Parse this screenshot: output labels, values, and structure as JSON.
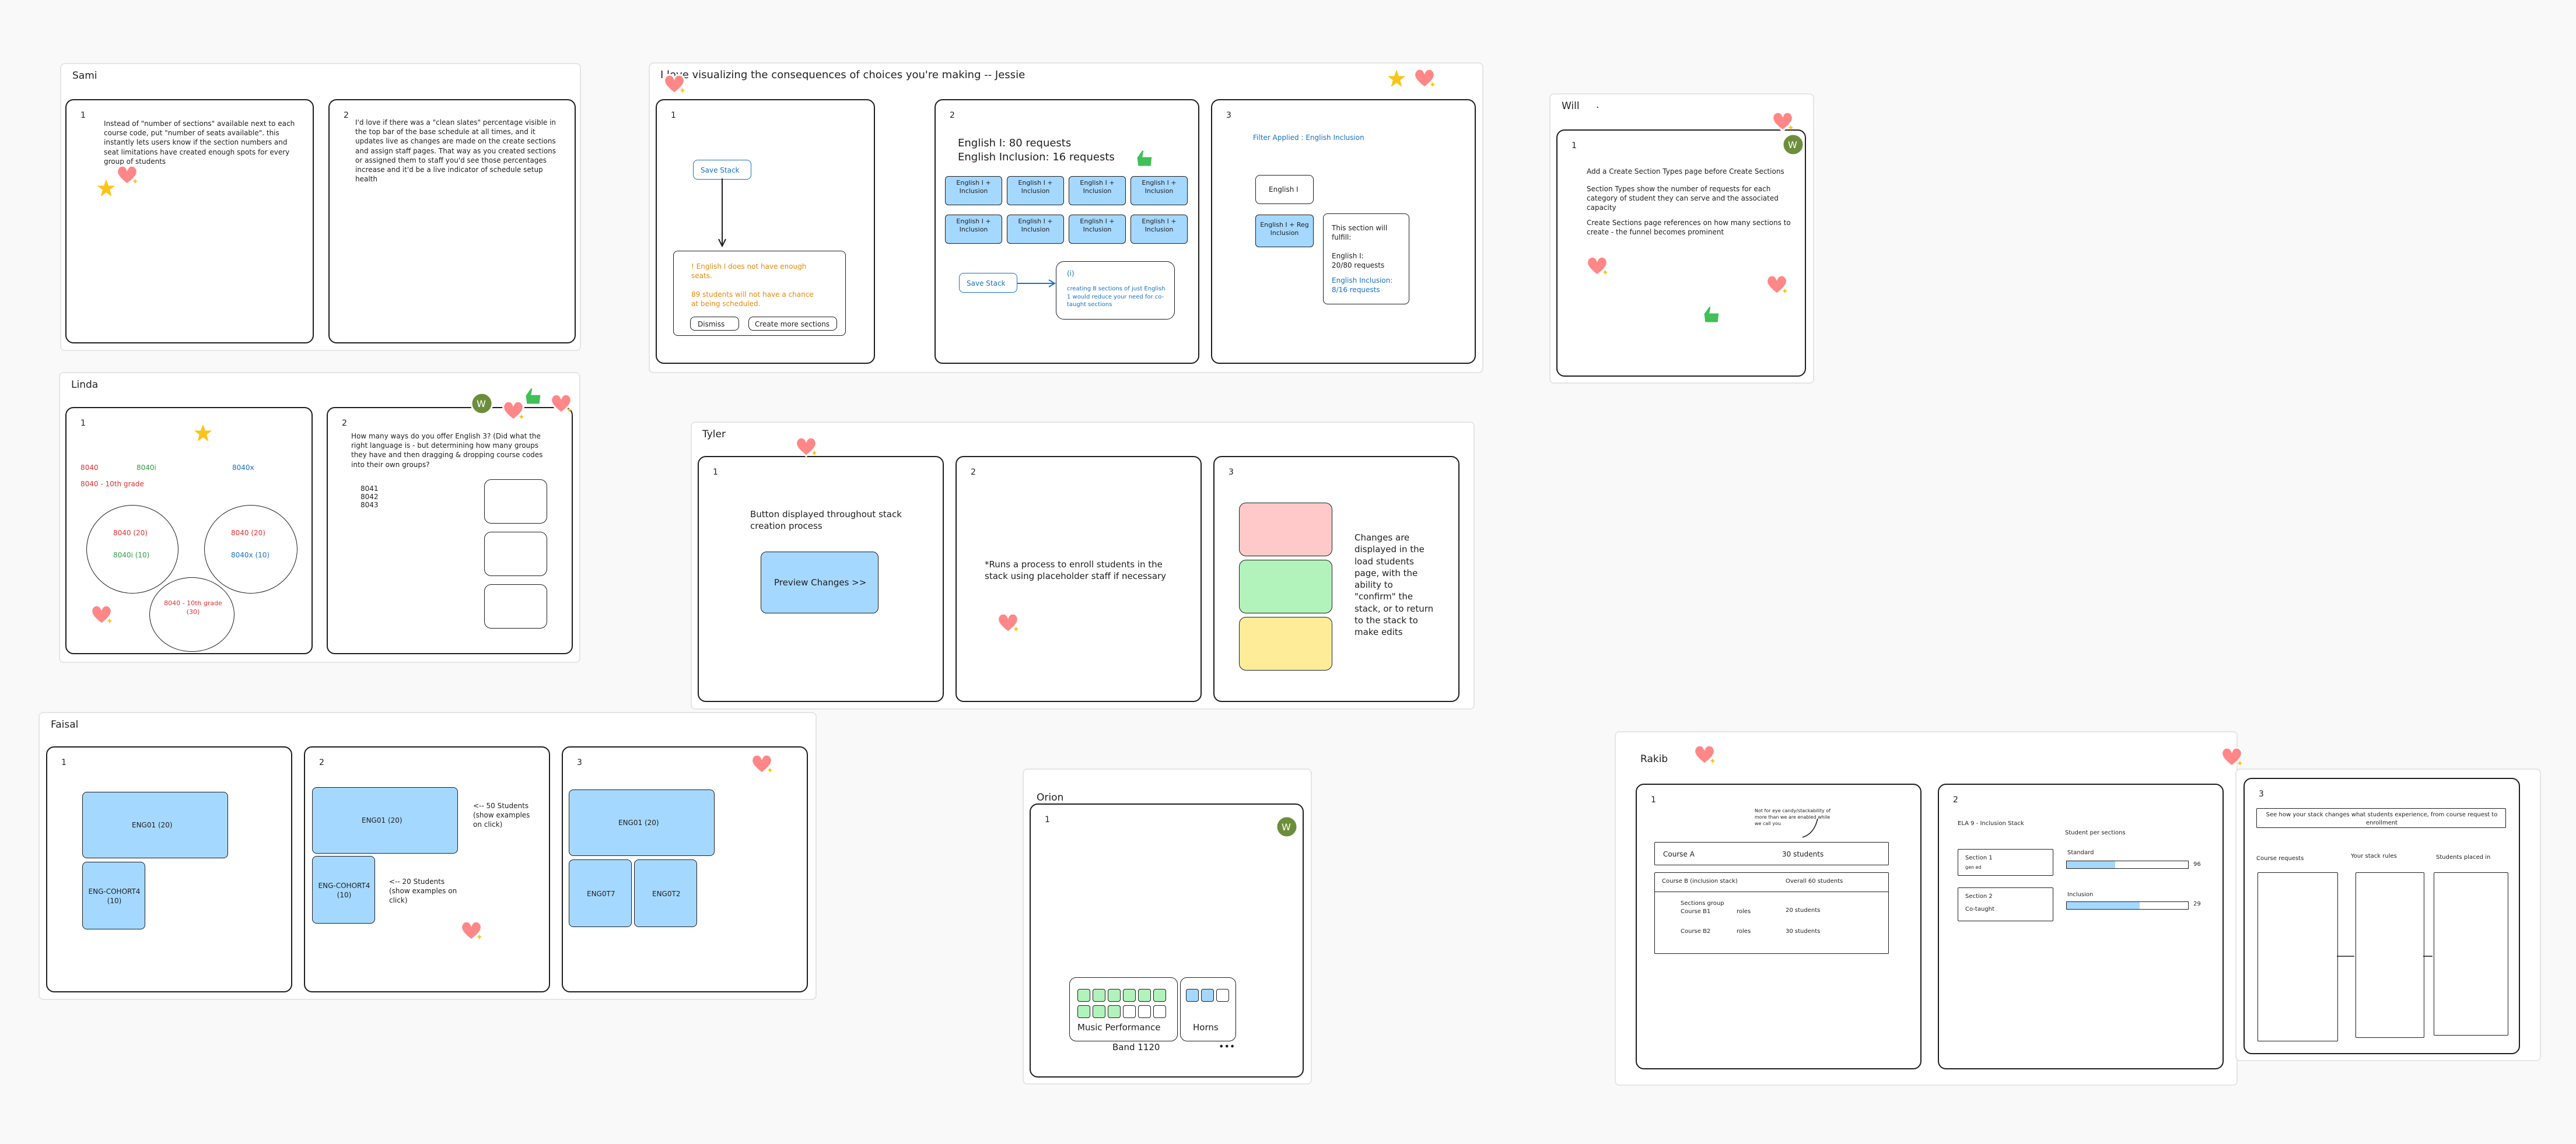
{
  "frames": {
    "sami": {
      "title": "Sami"
    },
    "jessie": {
      "title": "I love visualizing the consequences of choices you're making -- Jessie"
    },
    "will": {
      "title": "Will",
      "dot": "."
    },
    "linda": {
      "title": "Linda"
    },
    "tyler": {
      "title": "Tyler"
    },
    "faisal": {
      "title": "Faisal"
    },
    "orion": {
      "title": "Orion"
    },
    "rakib": {
      "title": "Rakib"
    }
  },
  "cards": {
    "sami1": {
      "num": "1",
      "text": "Instead of \"number of sections\" available next to each course code, put \"number of seats available\". this instantly lets users know if the section numbers and seat limitations have created enough spots for every group of students"
    },
    "sami2": {
      "num": "2",
      "text": "I'd love if there was a \"clean slates\" percentage visible in the top bar of the base schedule at all times, and it updates live as changes are made on the create sections and assign staff pages. That way as you created sections or assigned them to staff you'd see those percentages increase and it'd be a live indicator of schedule setup health"
    },
    "jessie1": {
      "num": "1",
      "save": "Save Stack",
      "warn1": "! English I does not have enough seats.",
      "warn2": "89 students will not have a chance at being scheduled.",
      "btn_dismiss": "Dismiss",
      "btn_create": "Create more sections"
    },
    "jessie2": {
      "num": "2",
      "head1": "English I: 80 requests",
      "head2": "English Inclusion: 16 requests",
      "cell": "English I + Inclusion",
      "save": "Save Stack",
      "note_mark": "(i)",
      "note": "creating 8 sections of just English 1 would reduce your need for co-taught sections"
    },
    "jessie3": {
      "num": "3",
      "filter": "Filter Applied : English Inclusion",
      "eng1": "English I",
      "eng_reg": "English I + Reg Inclusion",
      "fulfill": "This section will fulfill:",
      "eng_count": "English I:",
      "eng_req": "20/80 requests",
      "incl": "English Inclusion:",
      "incl_req": "8/16 requests"
    },
    "will1": {
      "num": "1",
      "line1": "Add a Create Section Types page before Create Sections",
      "line2": "Section Types show the number of requests for each category of student they can serve and the associated capacity",
      "line3": "Create Sections page references on how many sections to create - the funnel becomes prominent"
    },
    "linda1": {
      "num": "1",
      "a": "8040",
      "b": "8040x",
      "c": "8040i",
      "d": "8040 - 10th grade",
      "e1": "8040 (20)",
      "e2": "8040x (10)",
      "f1": "8040 (20)",
      "f2": "8040i (10)",
      "g": "8040 - 10th grade (30)"
    },
    "linda2": {
      "num": "2",
      "text": "How many ways do you offer English 3? (Did what the right language is - but determining how many groups they have and then dragging & dropping course codes into their own groups?",
      "codes": [
        "8041",
        "8042",
        "8043"
      ]
    },
    "tyler1": {
      "num": "1",
      "caption": "Button displayed throughout stack creation process",
      "btn": "Preview Changes >>"
    },
    "tyler2": {
      "num": "2",
      "text": "*Runs a process to enroll students in the stack using placeholder staff if necessary"
    },
    "tyler3": {
      "num": "3",
      "text": "Changes are displayed in the load students page, with the ability to \"confirm\" the stack, or to return to the stack to make edits"
    },
    "faisal1": {
      "num": "1",
      "big": "ENG01 (20)",
      "small": "ENG-COHORT4 (10)"
    },
    "faisal2": {
      "num": "2",
      "big": "ENG01 (20)",
      "small": "ENG-COHORT4 (10)",
      "note1": "<-- 50 Students (show examples on click)",
      "note2": "<-- 20 Students (show examples on click)"
    },
    "faisal3": {
      "num": "3",
      "big": "ENG01 (20)",
      "s1": "ENG0T7",
      "s2": "ENG0T2"
    },
    "orion1": {
      "num": "1",
      "label1": "Music Performance",
      "label2": "Horns",
      "band": "Band 1120",
      "dots": "•••"
    },
    "rakib1": {
      "num": "1",
      "top": "Not for eye candy/stackability of more than we are enabled while we call you",
      "course_a": "Course A",
      "stud30": "30 students",
      "course_b": "Course B (inclusion stack)",
      "overall": "Overall 60 students",
      "group": "Sections group Course B1",
      "roles1": "roles",
      "stud20": "20 students",
      "b2": "Course B2",
      "roles2": "roles",
      "stud30b": "30 students"
    },
    "rakib2": {
      "num": "2",
      "head": "ELA 9 - Inclusion Stack",
      "col": "Student per sections",
      "sec1": "Section 1",
      "sec1b": "gen ed",
      "std": "Standard",
      "val1": "96",
      "sec2": "Section 2",
      "sec2b": "Co-taught",
      "incl": "Inclusion",
      "val2": "29"
    },
    "rakib3": {
      "num": "3",
      "head": "See how your stack changes what students experience, from course request to enrollment",
      "c1": "Course requests",
      "c2": "Your stack rules",
      "c3": "Students placed in"
    }
  },
  "colors": {
    "blue": "#a5d8ff",
    "red": "#ffc9c9",
    "green": "#b2f2bb",
    "yellow": "#ffec99",
    "heart": "#ff8787",
    "star": "#fcc419",
    "thumb": "#40c057"
  }
}
